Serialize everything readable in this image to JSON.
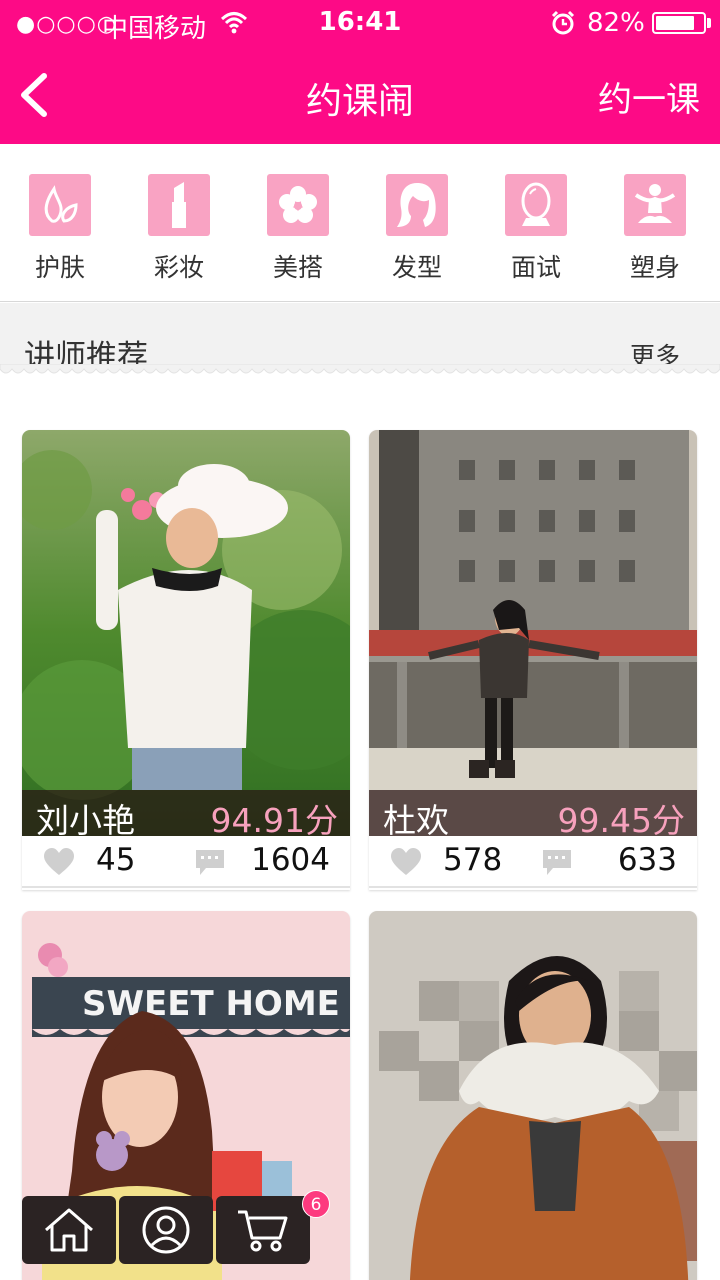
{
  "status_bar": {
    "signal": "●○○○○",
    "carrier": "中国移动",
    "time": "16:41",
    "battery_percent": "82%",
    "battery_level": 0.82
  },
  "nav": {
    "title": "约课闹",
    "action": "约一课",
    "back_icon": "chevron-left-icon",
    "color": "#fd0a86"
  },
  "categories": [
    {
      "label": "护肤",
      "icon": "skincare-icon"
    },
    {
      "label": "彩妆",
      "icon": "lipstick-icon"
    },
    {
      "label": "美搭",
      "icon": "flower-icon"
    },
    {
      "label": "发型",
      "icon": "hair-icon"
    },
    {
      "label": "面试",
      "icon": "mirror-icon"
    },
    {
      "label": "塑身",
      "icon": "yoga-icon"
    }
  ],
  "section": {
    "title": "讲师推荐",
    "more": "更多"
  },
  "teachers": [
    {
      "name": "刘小艳",
      "score": "94.91分",
      "likes": "45",
      "comments": "1604"
    },
    {
      "name": "杜欢",
      "score": "99.45分",
      "likes": "578",
      "comments": "633"
    },
    {
      "name": "",
      "score": "",
      "likes": "",
      "comments": ""
    },
    {
      "name": "",
      "score": "",
      "likes": "",
      "comments": ""
    }
  ],
  "photo_sign": "SWEET HOME",
  "tabbar": {
    "items": [
      "home-icon",
      "profile-icon",
      "cart-icon"
    ],
    "cart_badge": "6"
  }
}
